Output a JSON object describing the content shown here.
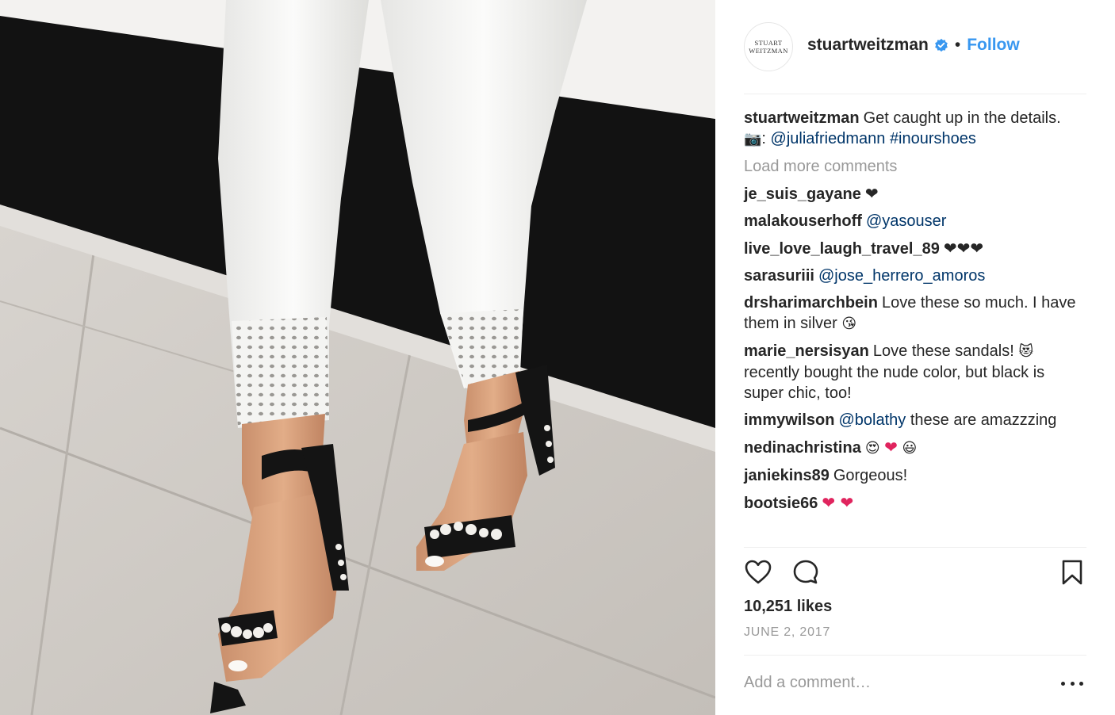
{
  "colors": {
    "link_blue": "#3897f0",
    "mention_blue": "#003569",
    "muted_gray": "#999999",
    "text": "#262626",
    "heart_red": "#e0245e"
  },
  "photo": {
    "icon": "post-photo"
  },
  "header": {
    "avatar_line1": "STUART",
    "avatar_line2": "WEITZMAN",
    "username": "stuartweitzman",
    "verified_icon": "verified-badge-icon",
    "separator": "•",
    "follow_label": "Follow"
  },
  "caption": {
    "user": "stuartweitzman",
    "text": "Get caught up in the details.",
    "camera_emoji": "📷",
    "colon": ":",
    "mention": "@juliafriedmann",
    "hashtag": "#inourshoes"
  },
  "load_more_label": "Load more comments",
  "comments": [
    {
      "user": "je_suis_gayane",
      "text": "❤"
    },
    {
      "user": "malakouserhoff",
      "mention": "@yasouser"
    },
    {
      "user": "live_love_laugh_travel_89",
      "text": "❤❤❤"
    },
    {
      "user": "sarasuriii",
      "mention": "@jose_herrero_amoros"
    },
    {
      "user": "drsharimarchbein",
      "text": "Love these so much. I have them in silver",
      "emoji": "😘"
    },
    {
      "user": "marie_nersisyan",
      "text": "Love these sandals!",
      "emoji": "😻",
      "text2": "recently bought the nude color, but black is super chic, too!"
    },
    {
      "user": "immywilson",
      "mention": "@bolathy",
      "text": "these are amazzzing"
    },
    {
      "user": "nedinachristina",
      "emoji": "😍",
      "heart": "❤",
      "emoji2": "😃"
    },
    {
      "user": "janiekins89",
      "text": "Gorgeous!"
    },
    {
      "user": "bootsie66",
      "heart": "❤ ❤"
    }
  ],
  "actions": {
    "like_icon": "heart-outline-icon",
    "comment_icon": "comment-bubble-icon",
    "save_icon": "bookmark-icon"
  },
  "likes": "10,251 likes",
  "date": "JUNE 2, 2017",
  "add_comment": {
    "placeholder": "Add a comment…"
  },
  "more_icon": "more-options-icon"
}
